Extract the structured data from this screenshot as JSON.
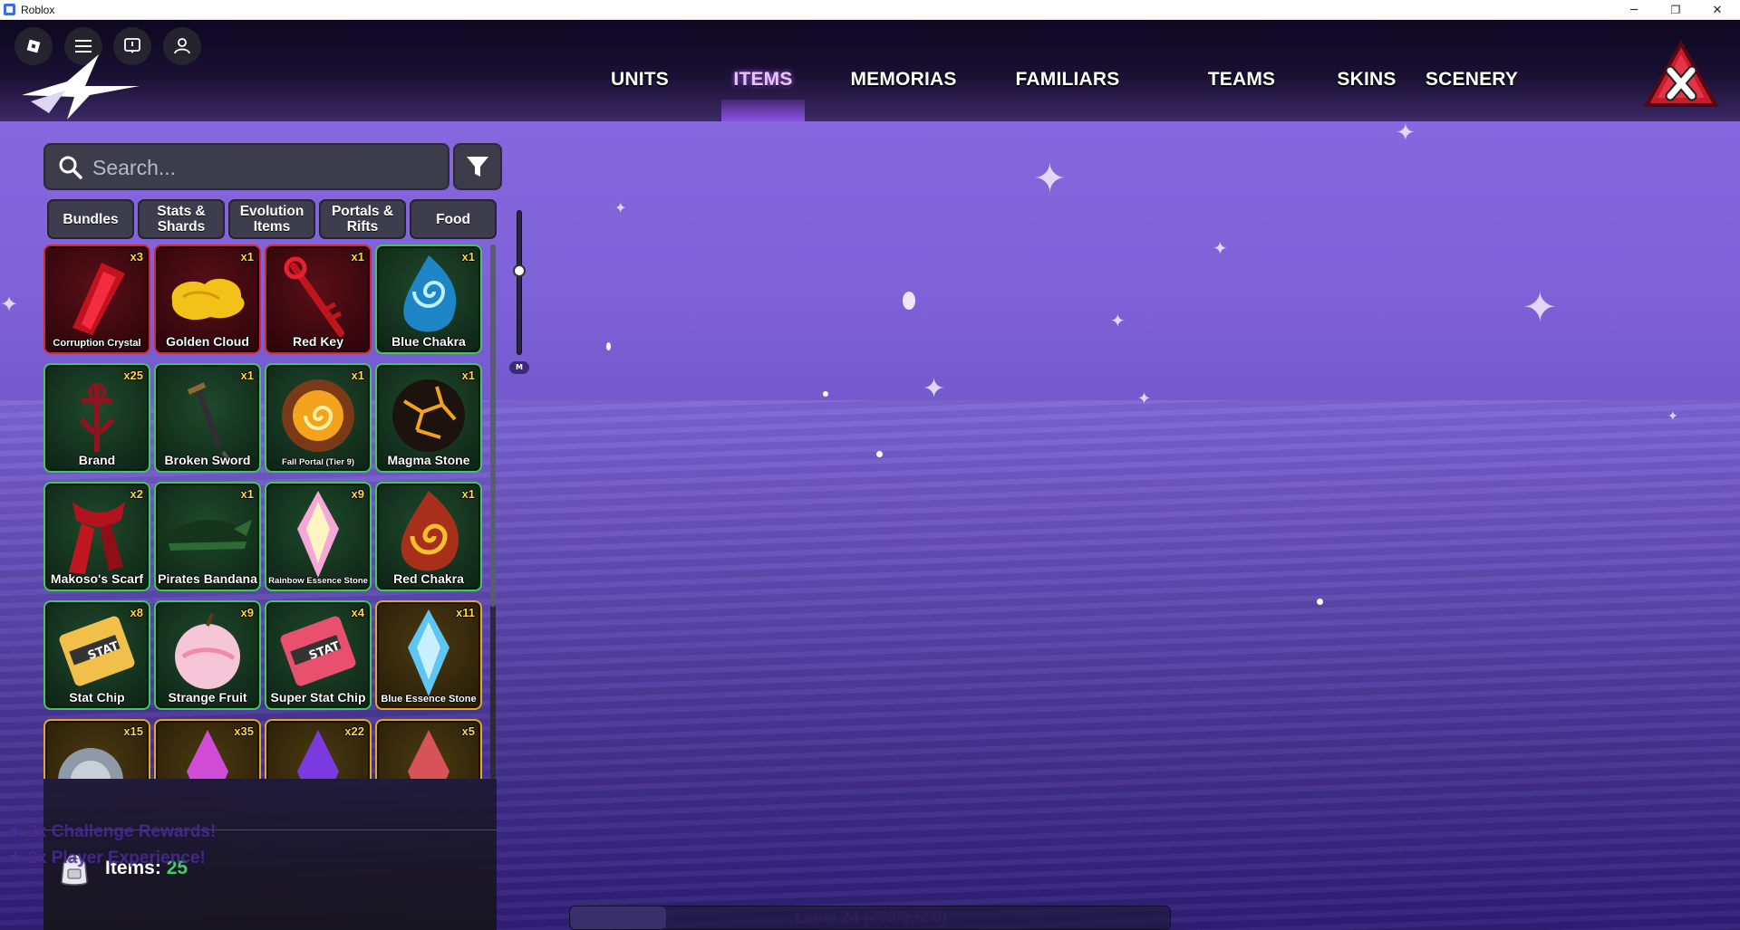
{
  "window": {
    "title": "Roblox",
    "minimize": "─",
    "restore": "❐",
    "close": "✕"
  },
  "nav": {
    "tabs": [
      {
        "label": "UNITS",
        "active": false
      },
      {
        "label": "ITEMS",
        "active": true
      },
      {
        "label": "MEMORIAS",
        "active": false
      },
      {
        "label": "FAMILIARS",
        "active": false
      },
      {
        "label": "TEAMS",
        "active": false
      },
      {
        "label": "SKINS",
        "active": false
      },
      {
        "label": "SCENERY",
        "active": false
      }
    ]
  },
  "search": {
    "placeholder": "Search..."
  },
  "categories": [
    {
      "label": "Bundles"
    },
    {
      "label": "Stats & Shards"
    },
    {
      "label": "Evolution Items"
    },
    {
      "label": "Portals & Rifts"
    },
    {
      "label": "Food"
    }
  ],
  "items": [
    {
      "name": "Corruption Crystal",
      "qty": "x3",
      "rarity": "red",
      "icon": "red-crystal-icon"
    },
    {
      "name": "Golden Cloud",
      "qty": "x1",
      "rarity": "red",
      "icon": "golden-cloud-icon"
    },
    {
      "name": "Red Key",
      "qty": "x1",
      "rarity": "red",
      "icon": "red-key-icon"
    },
    {
      "name": "Blue Chakra",
      "qty": "x1",
      "rarity": "green",
      "icon": "blue-chakra-icon"
    },
    {
      "name": "Brand",
      "qty": "x25",
      "rarity": "green",
      "icon": "brand-icon"
    },
    {
      "name": "Broken Sword",
      "qty": "x1",
      "rarity": "green",
      "icon": "broken-sword-icon"
    },
    {
      "name": "Fall Portal (Tier 9)",
      "qty": "x1",
      "rarity": "green",
      "icon": "portal-icon"
    },
    {
      "name": "Magma Stone",
      "qty": "x1",
      "rarity": "green",
      "icon": "magma-stone-icon"
    },
    {
      "name": "Makoso's Scarf",
      "qty": "x2",
      "rarity": "green",
      "icon": "scarf-icon"
    },
    {
      "name": "Pirates Bandana",
      "qty": "x1",
      "rarity": "green",
      "icon": "bandana-icon"
    },
    {
      "name": "Rainbow Essence Stone",
      "qty": "x9",
      "rarity": "green",
      "icon": "rainbow-essence-icon"
    },
    {
      "name": "Red Chakra",
      "qty": "x1",
      "rarity": "green",
      "icon": "red-chakra-icon"
    },
    {
      "name": "Stat Chip",
      "qty": "x8",
      "rarity": "green",
      "icon": "stat-chip-icon"
    },
    {
      "name": "Strange Fruit",
      "qty": "x9",
      "rarity": "green",
      "icon": "strange-fruit-icon"
    },
    {
      "name": "Super Stat Chip",
      "qty": "x4",
      "rarity": "green",
      "icon": "super-stat-chip-icon"
    },
    {
      "name": "Blue Essence Stone",
      "qty": "x11",
      "rarity": "gold",
      "icon": "blue-essence-icon"
    },
    {
      "name": "",
      "qty": "x15",
      "rarity": "gold",
      "icon": "silver-orb-icon"
    },
    {
      "name": "",
      "qty": "x35",
      "rarity": "gold",
      "icon": "pink-essence-icon"
    },
    {
      "name": "",
      "qty": "x22",
      "rarity": "gold",
      "icon": "purple-essence-icon"
    },
    {
      "name": "",
      "qty": "x5",
      "rarity": "gold",
      "icon": "red-essence-icon"
    }
  ],
  "zoom": {
    "label": "M"
  },
  "boosts": [
    "2x Challenge Rewards!",
    "2x Player Experience!"
  ],
  "footer": {
    "items_label": "Items:",
    "items_count": "25"
  },
  "level": {
    "text": "Level 24 (433/2,650)",
    "progress": 0.16
  },
  "colors": {
    "accent": "#b463ff",
    "count_green": "#3fd35a",
    "qty_gold": "#ffd74a",
    "red_rarity": "#d4263a",
    "green_rarity": "#3fc860",
    "gold_rarity": "#e0a920"
  }
}
